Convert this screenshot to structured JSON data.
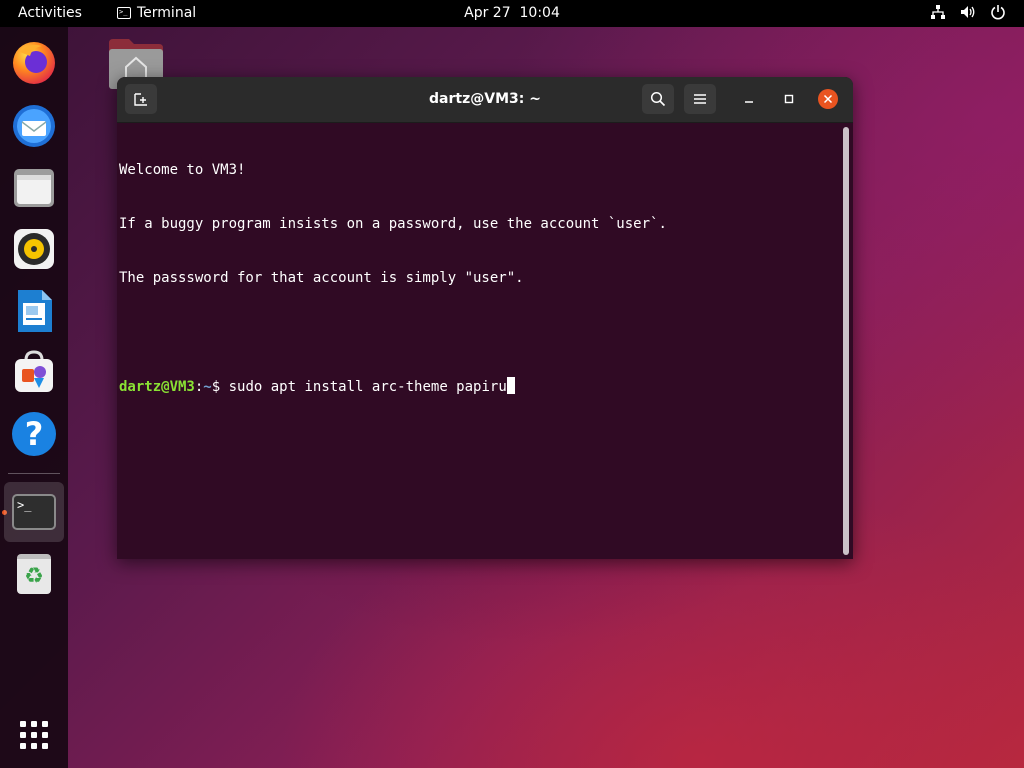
{
  "topbar": {
    "activities": "Activities",
    "app_name": "Terminal",
    "app_icon_glyph": ">_",
    "clock_date": "Apr 27",
    "clock_time": "10:04",
    "tray_icons": [
      "network-icon",
      "volume-icon",
      "power-icon"
    ]
  },
  "dock": {
    "items": [
      {
        "name": "firefox",
        "icon": "firefox-icon"
      },
      {
        "name": "thunderbird",
        "icon": "thunderbird-icon"
      },
      {
        "name": "files",
        "icon": "files-icon"
      },
      {
        "name": "rhythmbox",
        "icon": "rhythmbox-icon"
      },
      {
        "name": "libreoffice-writer",
        "icon": "writer-icon"
      },
      {
        "name": "software",
        "icon": "software-store-icon"
      },
      {
        "name": "help",
        "icon": "help-icon",
        "glyph": "?"
      },
      {
        "name": "terminal",
        "icon": "terminal-icon",
        "glyph": ">_",
        "running": true
      },
      {
        "name": "trash",
        "icon": "trash-icon",
        "glyph": "♻"
      },
      {
        "name": "show-applications",
        "icon": "app-grid-icon"
      }
    ]
  },
  "terminal": {
    "title": "dartz@VM3: ~",
    "lines": [
      "Welcome to VM3!",
      "If a buggy program insists on a password, use the account `user`.",
      "The passsword for that account is simply \"user\"."
    ],
    "prompt_user": "dartz@VM3",
    "prompt_sep": ":",
    "prompt_path": "~",
    "prompt_symbol": "$",
    "command": " sudo apt install arc-theme papiru"
  },
  "colors": {
    "accent": "#e95420",
    "terminal_bg": "#300a24",
    "prompt_user": "#8ae234",
    "prompt_path": "#729fcf"
  }
}
